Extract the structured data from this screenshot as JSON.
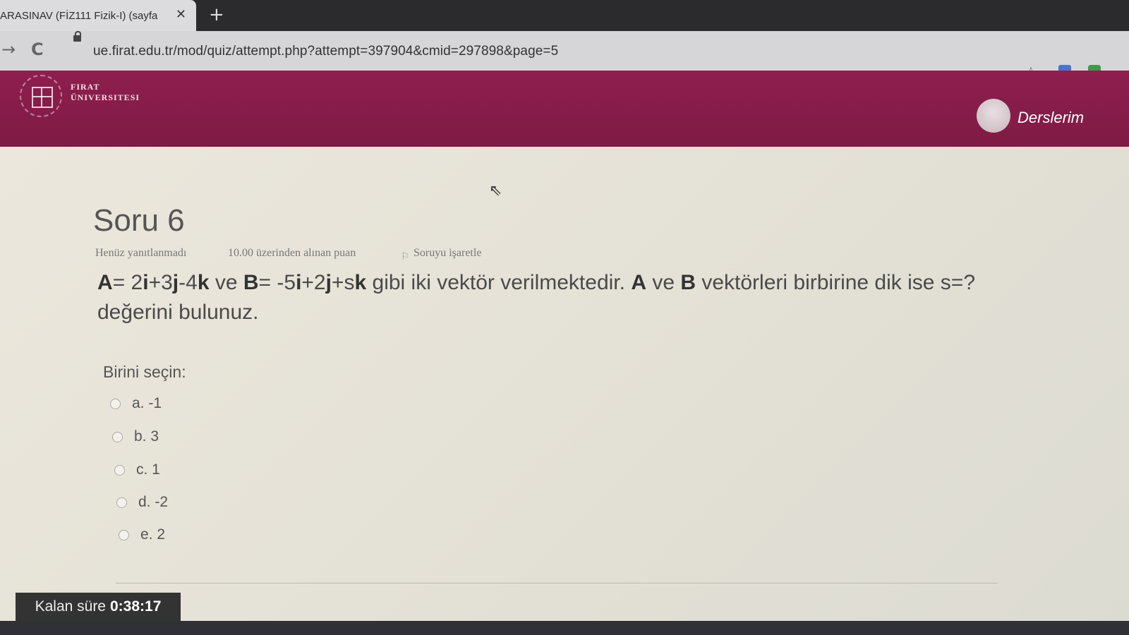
{
  "browser": {
    "tab_title": "ARASINAV (FİZ111 Fizik-I) (sayfa",
    "tab_close": "✕",
    "new_tab": "+",
    "back": "→",
    "reload": "C",
    "url": "ue.firat.edu.tr/mod/quiz/attempt.php?attempt=397904&cmid=297898&page=5",
    "star": "☆"
  },
  "header": {
    "university_line1": "FIRAT",
    "university_line2": "ÜNIVERSITESI",
    "courses_label": "Derslerim",
    "color": "#8e1e4e"
  },
  "question": {
    "title": "Soru 6",
    "status": "Henüz yanıtlanmadı",
    "points": "10.00 üzerinden alınan puan",
    "flag_label": "Soruyu işaretle",
    "text_A": "A",
    "text_1": "= 2",
    "text_i1": "i",
    "text_2": "+3",
    "text_j1": "j",
    "text_3": "-4",
    "text_k1": "k",
    "text_4": " ve ",
    "text_B": "B",
    "text_5": "= -5",
    "text_i2": "i",
    "text_6": "+2",
    "text_j2": "j",
    "text_7": "+s",
    "text_k2": "k",
    "text_8": " gibi iki vektör verilmektedir. ",
    "text_A2": "A",
    "text_9": " ve ",
    "text_B2": "B",
    "text_10": " vektörleri birbirine dik ise s=? değerini bulunuz.",
    "choose_label": "Birini seçin:",
    "options": [
      {
        "label": "a. -1"
      },
      {
        "label": "b. 3"
      },
      {
        "label": "c. 1"
      },
      {
        "label": "d. -2"
      },
      {
        "label": "e. 2"
      }
    ]
  },
  "timer": {
    "label": "Kalan süre",
    "value": "0:38:17"
  }
}
